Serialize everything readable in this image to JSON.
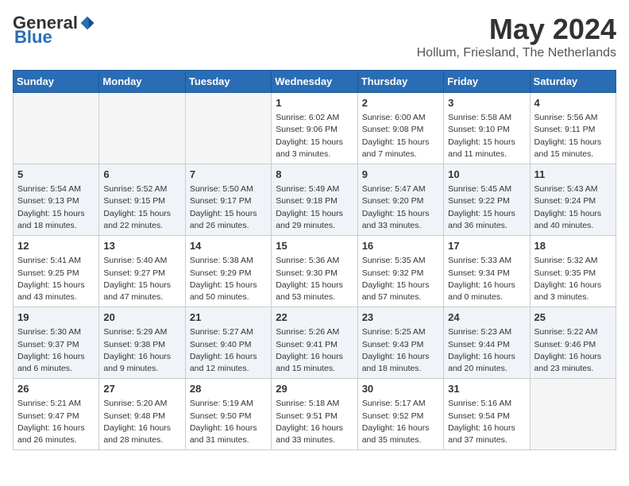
{
  "header": {
    "logo_general": "General",
    "logo_blue": "Blue",
    "title": "May 2024",
    "subtitle": "Hollum, Friesland, The Netherlands"
  },
  "days_of_week": [
    "Sunday",
    "Monday",
    "Tuesday",
    "Wednesday",
    "Thursday",
    "Friday",
    "Saturday"
  ],
  "weeks": [
    [
      {
        "day": "",
        "info": ""
      },
      {
        "day": "",
        "info": ""
      },
      {
        "day": "",
        "info": ""
      },
      {
        "day": "1",
        "info": "Sunrise: 6:02 AM\nSunset: 9:06 PM\nDaylight: 15 hours\nand 3 minutes."
      },
      {
        "day": "2",
        "info": "Sunrise: 6:00 AM\nSunset: 9:08 PM\nDaylight: 15 hours\nand 7 minutes."
      },
      {
        "day": "3",
        "info": "Sunrise: 5:58 AM\nSunset: 9:10 PM\nDaylight: 15 hours\nand 11 minutes."
      },
      {
        "day": "4",
        "info": "Sunrise: 5:56 AM\nSunset: 9:11 PM\nDaylight: 15 hours\nand 15 minutes."
      }
    ],
    [
      {
        "day": "5",
        "info": "Sunrise: 5:54 AM\nSunset: 9:13 PM\nDaylight: 15 hours\nand 18 minutes."
      },
      {
        "day": "6",
        "info": "Sunrise: 5:52 AM\nSunset: 9:15 PM\nDaylight: 15 hours\nand 22 minutes."
      },
      {
        "day": "7",
        "info": "Sunrise: 5:50 AM\nSunset: 9:17 PM\nDaylight: 15 hours\nand 26 minutes."
      },
      {
        "day": "8",
        "info": "Sunrise: 5:49 AM\nSunset: 9:18 PM\nDaylight: 15 hours\nand 29 minutes."
      },
      {
        "day": "9",
        "info": "Sunrise: 5:47 AM\nSunset: 9:20 PM\nDaylight: 15 hours\nand 33 minutes."
      },
      {
        "day": "10",
        "info": "Sunrise: 5:45 AM\nSunset: 9:22 PM\nDaylight: 15 hours\nand 36 minutes."
      },
      {
        "day": "11",
        "info": "Sunrise: 5:43 AM\nSunset: 9:24 PM\nDaylight: 15 hours\nand 40 minutes."
      }
    ],
    [
      {
        "day": "12",
        "info": "Sunrise: 5:41 AM\nSunset: 9:25 PM\nDaylight: 15 hours\nand 43 minutes."
      },
      {
        "day": "13",
        "info": "Sunrise: 5:40 AM\nSunset: 9:27 PM\nDaylight: 15 hours\nand 47 minutes."
      },
      {
        "day": "14",
        "info": "Sunrise: 5:38 AM\nSunset: 9:29 PM\nDaylight: 15 hours\nand 50 minutes."
      },
      {
        "day": "15",
        "info": "Sunrise: 5:36 AM\nSunset: 9:30 PM\nDaylight: 15 hours\nand 53 minutes."
      },
      {
        "day": "16",
        "info": "Sunrise: 5:35 AM\nSunset: 9:32 PM\nDaylight: 15 hours\nand 57 minutes."
      },
      {
        "day": "17",
        "info": "Sunrise: 5:33 AM\nSunset: 9:34 PM\nDaylight: 16 hours\nand 0 minutes."
      },
      {
        "day": "18",
        "info": "Sunrise: 5:32 AM\nSunset: 9:35 PM\nDaylight: 16 hours\nand 3 minutes."
      }
    ],
    [
      {
        "day": "19",
        "info": "Sunrise: 5:30 AM\nSunset: 9:37 PM\nDaylight: 16 hours\nand 6 minutes."
      },
      {
        "day": "20",
        "info": "Sunrise: 5:29 AM\nSunset: 9:38 PM\nDaylight: 16 hours\nand 9 minutes."
      },
      {
        "day": "21",
        "info": "Sunrise: 5:27 AM\nSunset: 9:40 PM\nDaylight: 16 hours\nand 12 minutes."
      },
      {
        "day": "22",
        "info": "Sunrise: 5:26 AM\nSunset: 9:41 PM\nDaylight: 16 hours\nand 15 minutes."
      },
      {
        "day": "23",
        "info": "Sunrise: 5:25 AM\nSunset: 9:43 PM\nDaylight: 16 hours\nand 18 minutes."
      },
      {
        "day": "24",
        "info": "Sunrise: 5:23 AM\nSunset: 9:44 PM\nDaylight: 16 hours\nand 20 minutes."
      },
      {
        "day": "25",
        "info": "Sunrise: 5:22 AM\nSunset: 9:46 PM\nDaylight: 16 hours\nand 23 minutes."
      }
    ],
    [
      {
        "day": "26",
        "info": "Sunrise: 5:21 AM\nSunset: 9:47 PM\nDaylight: 16 hours\nand 26 minutes."
      },
      {
        "day": "27",
        "info": "Sunrise: 5:20 AM\nSunset: 9:48 PM\nDaylight: 16 hours\nand 28 minutes."
      },
      {
        "day": "28",
        "info": "Sunrise: 5:19 AM\nSunset: 9:50 PM\nDaylight: 16 hours\nand 31 minutes."
      },
      {
        "day": "29",
        "info": "Sunrise: 5:18 AM\nSunset: 9:51 PM\nDaylight: 16 hours\nand 33 minutes."
      },
      {
        "day": "30",
        "info": "Sunrise: 5:17 AM\nSunset: 9:52 PM\nDaylight: 16 hours\nand 35 minutes."
      },
      {
        "day": "31",
        "info": "Sunrise: 5:16 AM\nSunset: 9:54 PM\nDaylight: 16 hours\nand 37 minutes."
      },
      {
        "day": "",
        "info": ""
      }
    ]
  ]
}
